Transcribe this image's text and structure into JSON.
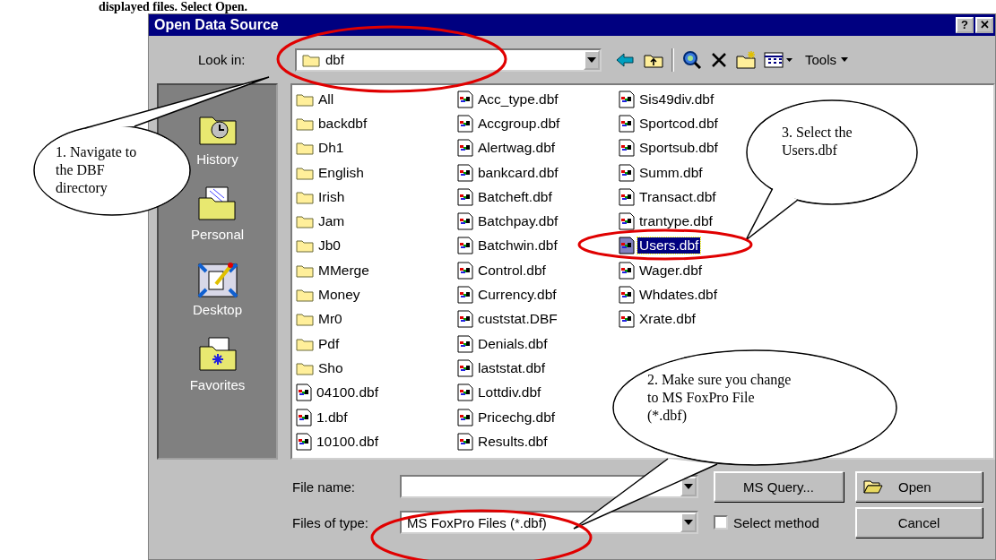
{
  "heading": "displayed files. Select **Open**.",
  "dialog": {
    "title": "Open Data Source",
    "title_buttons": [
      "?",
      "✕"
    ],
    "look_in": {
      "label": "Look in:",
      "value": "dbf"
    },
    "tools_label": "Tools",
    "places": [
      {
        "label": "History",
        "kind": "history"
      },
      {
        "label": "Personal",
        "kind": "personal"
      },
      {
        "label": "Desktop",
        "kind": "desktop"
      },
      {
        "label": "Favorites",
        "kind": "favorites"
      }
    ],
    "files": [
      {
        "name": "All",
        "kind": "folder",
        "selected": false
      },
      {
        "name": "backdbf",
        "kind": "folder",
        "selected": false
      },
      {
        "name": "Dh1",
        "kind": "folder",
        "selected": false
      },
      {
        "name": "English",
        "kind": "folder",
        "selected": false
      },
      {
        "name": "Irish",
        "kind": "folder",
        "selected": false
      },
      {
        "name": "Jam",
        "kind": "folder",
        "selected": false
      },
      {
        "name": "Jb0",
        "kind": "folder",
        "selected": false
      },
      {
        "name": "MMerge",
        "kind": "folder",
        "selected": false
      },
      {
        "name": "Money",
        "kind": "folder",
        "selected": false
      },
      {
        "name": "Mr0",
        "kind": "folder",
        "selected": false
      },
      {
        "name": "Pdf",
        "kind": "folder",
        "selected": false
      },
      {
        "name": "Sho",
        "kind": "folder",
        "selected": false
      },
      {
        "name": "04100.dbf",
        "kind": "file",
        "selected": false
      },
      {
        "name": "1.dbf",
        "kind": "file",
        "selected": false
      },
      {
        "name": "10100.dbf",
        "kind": "file",
        "selected": false
      },
      {
        "name": "Acc_type.dbf",
        "kind": "file",
        "selected": false
      },
      {
        "name": "Accgroup.dbf",
        "kind": "file",
        "selected": false
      },
      {
        "name": "Alertwag.dbf",
        "kind": "file",
        "selected": false
      },
      {
        "name": "bankcard.dbf",
        "kind": "file",
        "selected": false
      },
      {
        "name": "Batcheft.dbf",
        "kind": "file",
        "selected": false
      },
      {
        "name": "Batchpay.dbf",
        "kind": "file",
        "selected": false
      },
      {
        "name": "Batchwin.dbf",
        "kind": "file",
        "selected": false
      },
      {
        "name": "Control.dbf",
        "kind": "file",
        "selected": false
      },
      {
        "name": "Currency.dbf",
        "kind": "file",
        "selected": false
      },
      {
        "name": "custstat.DBF",
        "kind": "file",
        "selected": false
      },
      {
        "name": "Denials.dbf",
        "kind": "file",
        "selected": false
      },
      {
        "name": "laststat.dbf",
        "kind": "file",
        "selected": false
      },
      {
        "name": "Lottdiv.dbf",
        "kind": "file",
        "selected": false
      },
      {
        "name": "Pricechg.dbf",
        "kind": "file",
        "selected": false
      },
      {
        "name": "Results.dbf",
        "kind": "file",
        "selected": false
      },
      {
        "name": "Sis49div.dbf",
        "kind": "file",
        "selected": false
      },
      {
        "name": "Sportcod.dbf",
        "kind": "file",
        "selected": false
      },
      {
        "name": "Sportsub.dbf",
        "kind": "file",
        "selected": false
      },
      {
        "name": "Summ.dbf",
        "kind": "file",
        "selected": false
      },
      {
        "name": "Transact.dbf",
        "kind": "file",
        "selected": false
      },
      {
        "name": "trantype.dbf",
        "kind": "file",
        "selected": false
      },
      {
        "name": "Users.dbf",
        "kind": "file",
        "selected": true
      },
      {
        "name": "Wager.dbf",
        "kind": "file",
        "selected": false
      },
      {
        "name": "Whdates.dbf",
        "kind": "file",
        "selected": false
      },
      {
        "name": "Xrate.dbf",
        "kind": "file",
        "selected": false
      }
    ],
    "file_name": {
      "label": "File name:"
    },
    "files_of_type": {
      "label": "Files of type:",
      "value": "MS FoxPro Files (*.dbf)"
    },
    "select_method": {
      "label": "Select method",
      "checked": false
    },
    "buttons": [
      {
        "label": "MS Query...",
        "kind": "query"
      },
      {
        "label": "Open",
        "kind": "open"
      },
      {
        "label": "Cancel",
        "kind": "cancel"
      }
    ]
  },
  "callouts": [
    {
      "text": "1. Navigate to the DBF directory"
    },
    {
      "text": "2. Make sure you change to MS FoxPro File (*.dbf)"
    },
    {
      "text": "3. Select the Users.dbf"
    }
  ]
}
